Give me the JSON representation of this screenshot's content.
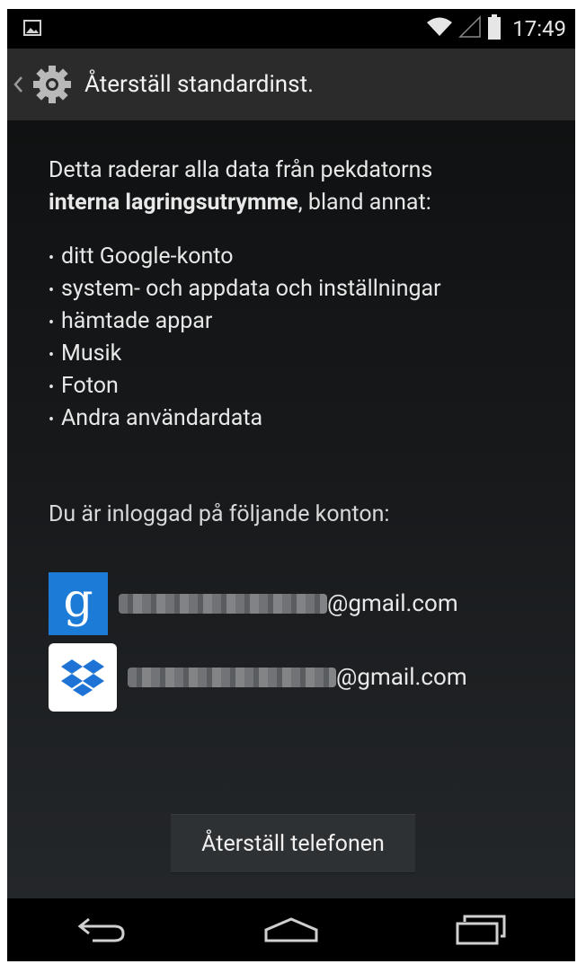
{
  "status_bar": {
    "time": "17:49",
    "icons": [
      "image-notification-icon",
      "wifi-icon",
      "signal-icon",
      "battery-icon"
    ]
  },
  "action_bar": {
    "title": "Återställ standardinst.",
    "icons": [
      "up-caret-icon",
      "settings-gear-icon"
    ]
  },
  "content": {
    "intro_normal": "Detta raderar alla data från pekdatorns",
    "intro_bold": "interna lagringsutrymme",
    "intro_tail": ", bland annat:",
    "bullets": [
      "ditt Google-konto",
      "system- och appdata och inställningar",
      "hämtade appar",
      "Musik",
      "Foton",
      "Andra användardata"
    ],
    "accounts_label": "Du är inloggad på följande konton:",
    "accounts": [
      {
        "service_icon": "google-icon",
        "glyph": "g",
        "email_suffix": "@gmail.com"
      },
      {
        "service_icon": "dropbox-icon",
        "glyph": "",
        "email_suffix": "@gmail.com"
      }
    ],
    "reset_button": "Återställ telefonen"
  },
  "nav_bar": {
    "buttons": [
      "back-icon",
      "home-icon",
      "recent-apps-icon"
    ]
  },
  "colors": {
    "action_bar_bg": "#2b2b2b",
    "google_blue": "#1c7bd6",
    "dropbox_blue": "#1f73d6"
  }
}
